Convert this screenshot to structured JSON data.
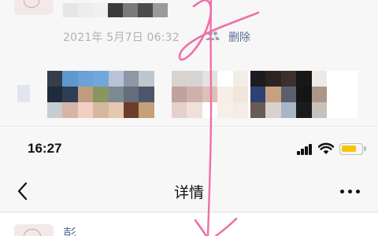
{
  "feed": {
    "timestamp": "2021年 5月7日 06:32",
    "delete_label": "删除",
    "name_mosaic_colors": [
      "#e6e6e6",
      "#ededed",
      "#f0f0f0",
      "#3a3a3a",
      "#7a7a7a",
      "#4b4b4b",
      "#9a9a9a"
    ],
    "photo_mosaics": [
      {
        "cells": [
          "#343e4b",
          "#5f99cc",
          "#6ba1d8",
          "#70a7dc",
          "#b9c2d9",
          "#8e98a5",
          "#c0c6ce",
          "#1f2a3c",
          "#2d3e54",
          "#be9d7f",
          "#8a9560",
          "#7a8a90",
          "#646e7a",
          "#4b566a",
          "#c7ccd3",
          "#d5b6a6",
          "#f1cfc6",
          "#d6b89e",
          "#e6c7b1",
          "#6e3d29",
          "#c5a07a"
        ]
      },
      {
        "cells": [
          "#d9d2cf",
          "#d6d4d2",
          "#e5e2df",
          "#ffffff",
          "#f3ede8",
          "#ffffff",
          "#ffffff",
          "#c1a39d",
          "#cfb0ab",
          "#dcc1b5",
          "#f7eee6",
          "#f2e6db",
          "#ffffff",
          "#ffffff",
          "#e5d1cb",
          "#efe1da",
          "#ffffff",
          "#f7efe8",
          "#f5ede3",
          "#ffffff",
          "#ffffff"
        ]
      },
      {
        "cells": [
          "#1c1b1f",
          "#2b2423",
          "#3c2f2c",
          "#1a1718",
          "#efe9e5",
          "#ffffff",
          "#ffffff",
          "#2e4173",
          "#c6a07f",
          "#5a5f6b",
          "#161516",
          "#a9978b",
          "#ffffff",
          "#ffffff",
          "#6a5a55",
          "#d7d2cd",
          "#a8b5c5",
          "#1b1a1d",
          "#c8c0ba",
          "#ffffff",
          "#ffffff"
        ]
      }
    ]
  },
  "status_bar": {
    "time": "16:27"
  },
  "nav": {
    "title": "详情"
  },
  "detail": {
    "name": "彭"
  },
  "colors": {
    "link": "#5c7096",
    "battery": "#f7c600",
    "ink": "#ef6fa8"
  },
  "icons": [
    "people-icon",
    "back-chevron-icon",
    "more-dots-icon",
    "signal-icon",
    "wifi-icon",
    "battery-icon"
  ]
}
